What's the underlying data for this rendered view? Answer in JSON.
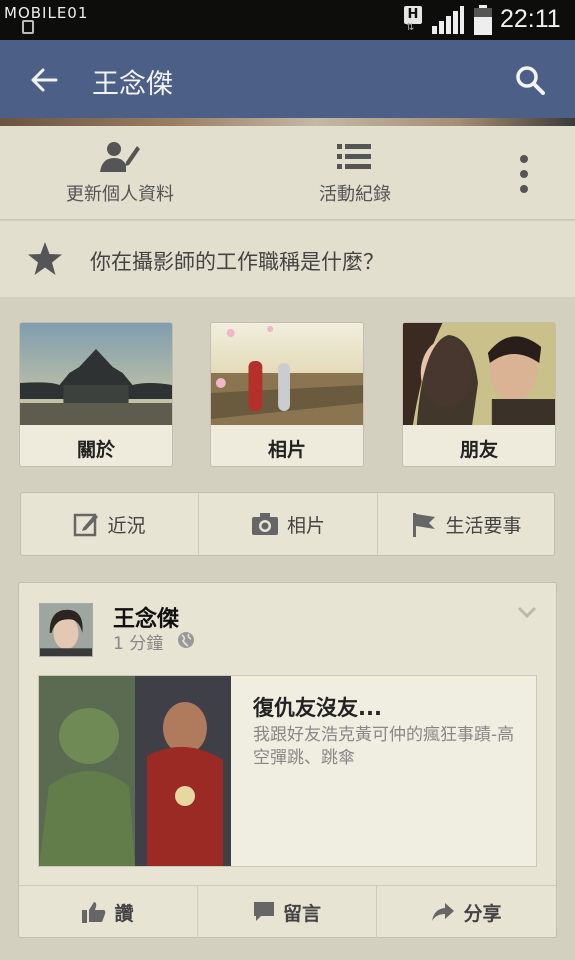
{
  "status_bar": {
    "brand": "MOBILE01",
    "network": "H",
    "time": "22:11"
  },
  "app_bar": {
    "title": "王念傑",
    "back_icon": "back-arrow-icon",
    "search_icon": "search-icon",
    "color": "#4c5f86"
  },
  "profile_actions": [
    {
      "label": "更新個人資料",
      "icon": "edit-profile-icon"
    },
    {
      "label": "活動紀錄",
      "icon": "list-icon"
    }
  ],
  "question": {
    "text": "你在攝影師的工作職稱是什麼？",
    "icon": "star-icon"
  },
  "tiles": [
    {
      "label": "關於"
    },
    {
      "label": "相片"
    },
    {
      "label": "朋友"
    }
  ],
  "composer": [
    {
      "label": "近況",
      "icon": "pencil-icon"
    },
    {
      "label": "相片",
      "icon": "camera-icon"
    },
    {
      "label": "生活要事",
      "icon": "flag-icon"
    }
  ],
  "post": {
    "author": "王念傑",
    "time": "1 分鐘",
    "link": {
      "title": "復仇友沒友...",
      "description": "我跟好友浩克黃可仲的瘋狂事蹟-高空彈跳、跳傘"
    },
    "actions": [
      {
        "label": "讚",
        "icon": "thumbs-up-icon"
      },
      {
        "label": "留言",
        "icon": "comment-icon"
      },
      {
        "label": "分享",
        "icon": "share-icon"
      }
    ]
  }
}
